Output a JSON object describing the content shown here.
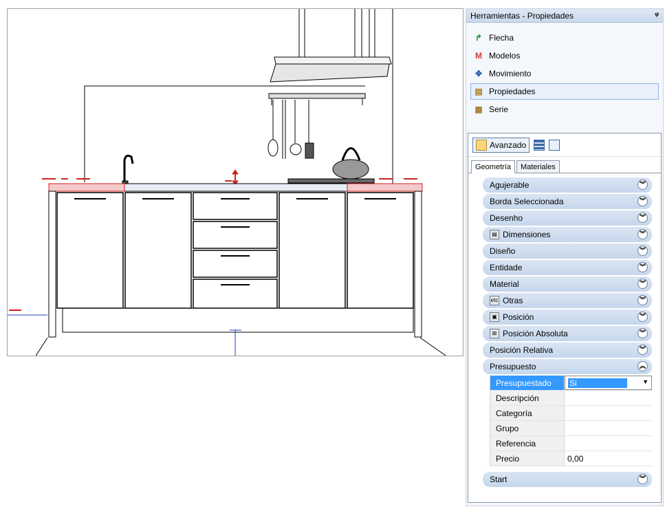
{
  "panel": {
    "title": "Herramientas - Propiedades",
    "pin_icon": "pin-icon",
    "tools": [
      {
        "label": "Flecha",
        "icon": "arrow-icon"
      },
      {
        "label": "Modelos",
        "icon": "models-icon"
      },
      {
        "label": "Movimiento",
        "icon": "move-icon"
      },
      {
        "label": "Propiedades",
        "icon": "properties-icon"
      },
      {
        "label": "Serie",
        "icon": "series-icon"
      }
    ],
    "active_tool": "Propiedades"
  },
  "props": {
    "advanced_label": "Avanzado",
    "tabs": [
      "Geometría",
      "Materiales"
    ],
    "active_tab": "Geometría",
    "groups_top": [
      {
        "label": "Agujerable"
      },
      {
        "label": "Borda Seleccionada"
      },
      {
        "label": "Desenho"
      },
      {
        "label": "Dimensiones",
        "icon": "dimensions-icon"
      },
      {
        "label": "Diseño"
      },
      {
        "label": "Entidade"
      },
      {
        "label": "Material"
      },
      {
        "label": "Otras",
        "icon": "etc-icon",
        "icon_text": "etc"
      },
      {
        "label": "Posición",
        "icon": "position-icon"
      },
      {
        "label": "Posición Absoluta",
        "icon": "absolute-position-icon"
      },
      {
        "label": "Posición Relativa"
      },
      {
        "label": "Presupuesto",
        "expanded": true
      }
    ],
    "budget_rows": [
      {
        "key": "Presupuestado",
        "value": "Si",
        "selected": true
      },
      {
        "key": "Descripción",
        "value": ""
      },
      {
        "key": "Categoría",
        "value": ""
      },
      {
        "key": "Grupo",
        "value": ""
      },
      {
        "key": "Referencia",
        "value": ""
      },
      {
        "key": "Precio",
        "value": "0,00"
      }
    ],
    "groups_bottom": [
      {
        "label": "Start"
      }
    ]
  },
  "colors": {
    "selection": "#3399ff",
    "group_bg": "#c6d7ec",
    "countertop_highlight": "#cc2222"
  }
}
